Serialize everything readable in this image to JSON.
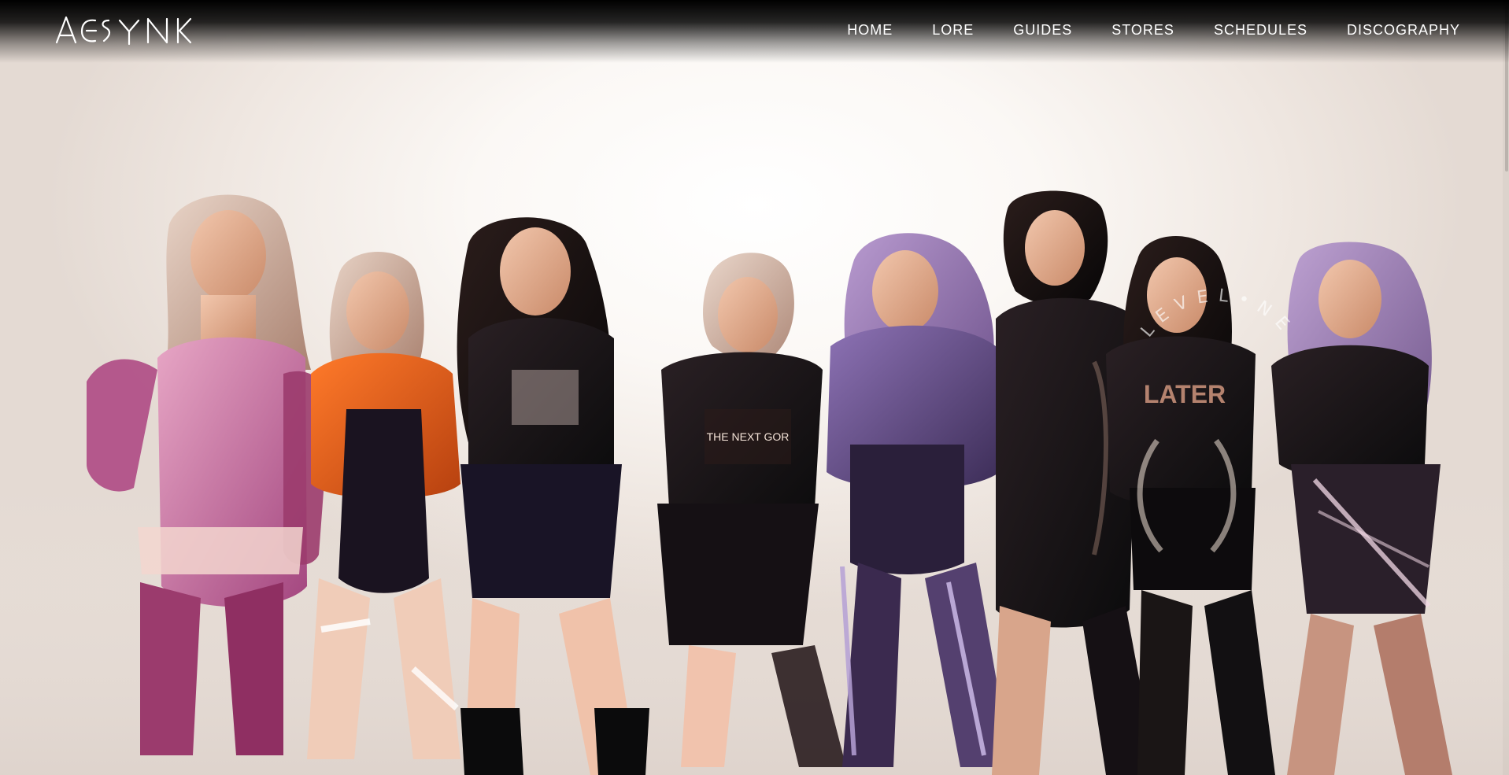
{
  "brand": {
    "name": "AESYNK"
  },
  "nav": {
    "items": [
      {
        "label": "HOME"
      },
      {
        "label": "LORE"
      },
      {
        "label": "GUIDES"
      },
      {
        "label": "STORES"
      },
      {
        "label": "SCHEDULES"
      },
      {
        "label": "DISCOGRAPHY"
      }
    ]
  },
  "hero": {
    "arc_text": "LEVEL•NEXT•APP",
    "shirt_text_1": "THE NEXT GOR",
    "shirt_text_2": "LATER"
  },
  "colors": {
    "header_bg": "#000000",
    "nav_text": "#ffffff",
    "hero_bg": "#f5efea"
  }
}
